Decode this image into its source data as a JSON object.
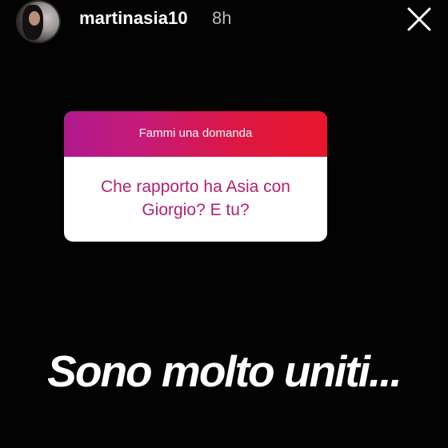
{
  "header": {
    "username": "martinasia10",
    "time": "8h"
  },
  "sticker": {
    "title": "Fammi una domanda",
    "question": "Che rapporto ha Asia con Giorgio? E tu?"
  },
  "answer": "Sono molto uniti...",
  "colors": {
    "background": "#030303",
    "sticker_gradient_start": "#b0198c",
    "sticker_gradient_end": "#e8162a",
    "question_text": "#b52072"
  },
  "icons": {
    "close": "close-icon"
  }
}
